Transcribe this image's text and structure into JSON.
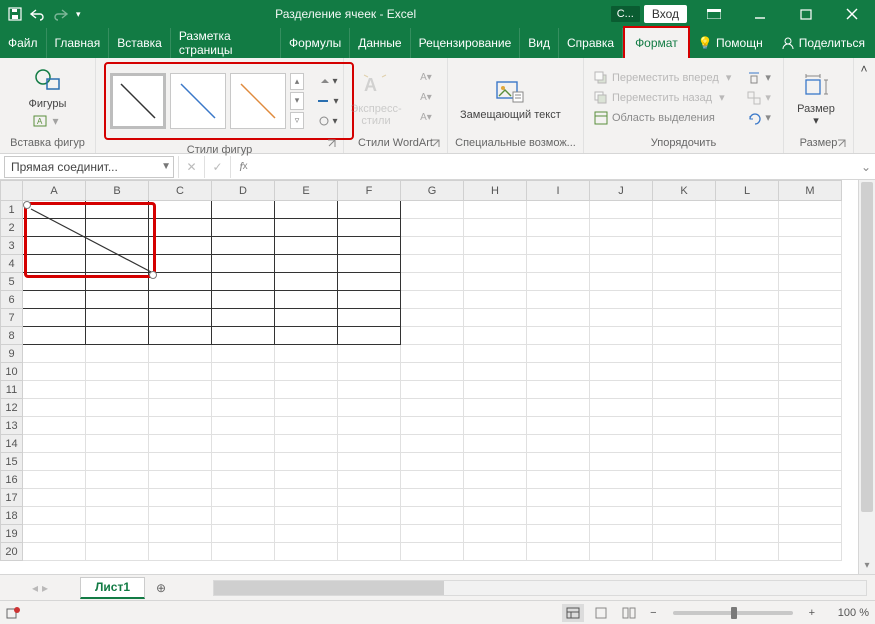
{
  "titlebar": {
    "title": "Разделение ячеек  -  Excel",
    "login": "Вход",
    "context_prefix": "С..."
  },
  "menu": {
    "tabs": [
      "Файл",
      "Главная",
      "Вставка",
      "Разметка страницы",
      "Формулы",
      "Данные",
      "Рецензирование",
      "Вид",
      "Справка",
      "Формат"
    ],
    "help": "Помощн",
    "share": "Поделиться"
  },
  "ribbon": {
    "insert_shapes_group": "Вставка фигур",
    "shapes": "Фигуры",
    "shape_styles_group": "Стили фигур",
    "wordart_group": "Стили WordArt",
    "express_styles": "Экспресс-стили",
    "accessibility_group": "Специальные возмож...",
    "alt_text": "Замещающий текст",
    "bring_forward": "Переместить вперед",
    "send_backward": "Переместить назад",
    "selection_pane": "Область выделения",
    "arrange_group": "Упорядочить",
    "size_group": "Размер",
    "size": "Размер"
  },
  "namebox": "Прямая соединит...",
  "columns": [
    "A",
    "B",
    "C",
    "D",
    "E",
    "F",
    "G",
    "H",
    "I",
    "J",
    "K",
    "L",
    "M"
  ],
  "rows": [
    1,
    2,
    3,
    4,
    5,
    6,
    7,
    8,
    9,
    10,
    11,
    12,
    13,
    14,
    15,
    16,
    17,
    18,
    19,
    20
  ],
  "bordered_range": {
    "cols": 6,
    "rows": 8
  },
  "sheet_tab": "Лист1",
  "zoom": "100 %"
}
